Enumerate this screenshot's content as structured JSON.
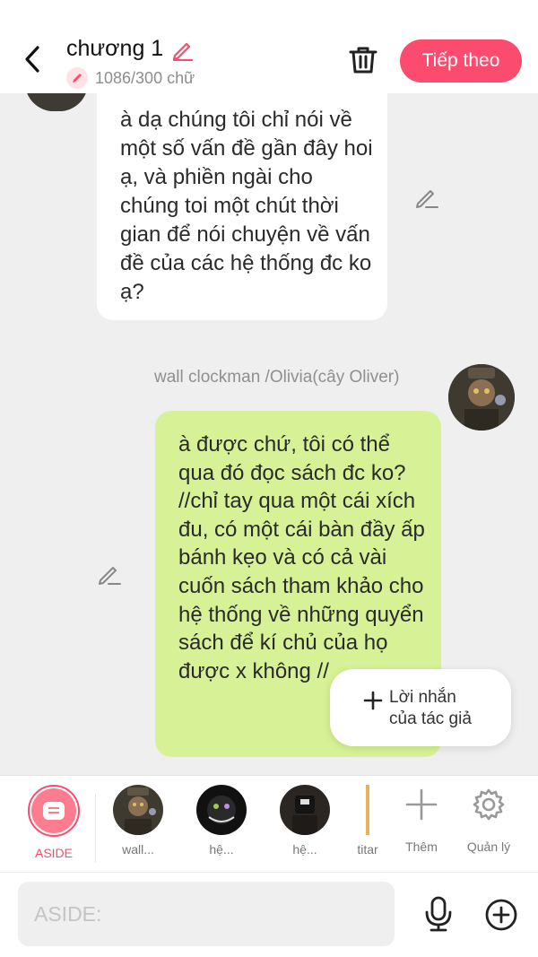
{
  "header": {
    "title": "chương 1",
    "char_count": "1086/300 chữ",
    "next_label": "Tiếp theo"
  },
  "messages": [
    {
      "side": "left",
      "text": "à dạ chúng tôi chỉ nói về một số vấn đề gần đây hoi ạ,  và phiền ngài cho chúng toi một chút thời gian để nói chuyện về vấn đề của các hệ thống đc ko ạ?"
    },
    {
      "side": "right",
      "sender": "wall clockman /Olivia(cây Oliver)",
      "text": "à được chứ, tôi có thể qua đó đọc sách đc ko? //chỉ tay qua một cái xích đu, có một cái bàn đầy ấp bánh kẹo và có cả vài cuốn sách tham khảo cho hệ thống về những quyển sách để kí chủ của họ được x không //"
    }
  ],
  "author_note": {
    "label": "Lời nhắn của tác giả"
  },
  "characters": [
    {
      "label": "ASIDE",
      "active": true
    },
    {
      "label": "wall..."
    },
    {
      "label": "hệ..."
    },
    {
      "label": "hệ..."
    },
    {
      "label": "titar"
    }
  ],
  "tools": {
    "add_label": "Thêm",
    "manage_label": "Quản lý"
  },
  "input": {
    "placeholder": "ASIDE:"
  },
  "colors": {
    "accent": "#fb4b6e",
    "green_bubble": "#d7f296",
    "background": "#efefef"
  }
}
